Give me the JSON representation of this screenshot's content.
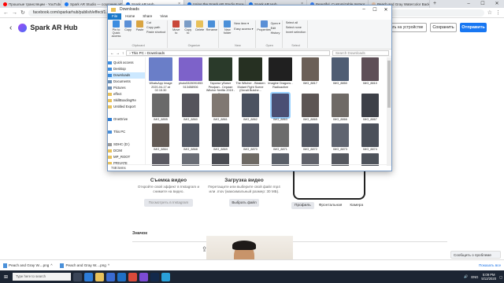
{
  "browser": {
    "tabs": [
      {
        "label": "Прошлые трансляции - YouTube",
        "color": "#ff0000"
      },
      {
        "label": "Spark AR Studio — создание эф...",
        "color": "#1877f2"
      },
      {
        "label": "Spark AR Hub",
        "color": "#1877f2",
        "active": true
      },
      {
        "label": "Using the Spark AR Studio Face...",
        "color": "#1877f2"
      },
      {
        "label": "Spark AR Hub",
        "color": "#1877f2"
      },
      {
        "label": "Beautiful, Customizable Instagr...",
        "color": "#3b82f6"
      },
      {
        "label": "Peach and Gray Watercolor Back...",
        "color": "#e3c2a8"
      }
    ],
    "url": "facebook.com/sparkarhub/publish/effect/1..."
  },
  "spark": {
    "title": "Spark AR Hub",
    "test_button": "Тестировать на устройстве",
    "save_button": "Сохранить",
    "send_button": "Отправить"
  },
  "explorer": {
    "title": "Downloads",
    "ribbon_tabs": [
      "File",
      "Home",
      "Share",
      "View"
    ],
    "groups": [
      {
        "label": "Clipboard",
        "items": [
          "Pin to Quick access",
          "Copy",
          "Paste"
        ],
        "small": [
          "Cut",
          "Copy path",
          "Paste shortcut"
        ]
      },
      {
        "label": "Organize",
        "items": [
          "Move to",
          "Copy to",
          "Delete",
          "Rename"
        ],
        "small": []
      },
      {
        "label": "New",
        "items": [
          "New folder"
        ],
        "small": [
          "New item ▾",
          "Easy access ▾"
        ]
      },
      {
        "label": "Open",
        "items": [
          "Properties"
        ],
        "small": [
          "Open ▾",
          "Edit",
          "History"
        ]
      },
      {
        "label": "Select",
        "items": [],
        "small": [
          "Select all",
          "Select none",
          "Invert selection"
        ]
      }
    ],
    "path": "› This PC › Downloads",
    "search_placeholder": "Search Downloads",
    "nav": [
      {
        "label": "Quick access",
        "icon": "#3c8de0"
      },
      {
        "label": "Desktop",
        "icon": "#3c8de0"
      },
      {
        "label": "Downloads",
        "icon": "#3c8de0",
        "selected": true
      },
      {
        "label": "Documents",
        "icon": "#6d8fb3"
      },
      {
        "label": "Pictures",
        "icon": "#6d8fb3"
      },
      {
        "label": "effect",
        "icon": "#e8c15a"
      },
      {
        "label": "SkillBoxdingRe",
        "icon": "#e8c15a"
      },
      {
        "label": "Untitled Export",
        "icon": "#e8c15a"
      },
      {
        "label": "",
        "icon": "transparent"
      },
      {
        "label": "OneDrive",
        "icon": "#2a7bd4"
      },
      {
        "label": "",
        "icon": "transparent"
      },
      {
        "label": "This PC",
        "icon": "#4a8fd8"
      },
      {
        "label": "",
        "icon": "transparent"
      },
      {
        "label": "SDHC (D:)",
        "icon": "#999999"
      },
      {
        "label": "DCIM",
        "icon": "#e8c15a"
      },
      {
        "label": "MP_ROOT",
        "icon": "#e8c15a"
      },
      {
        "label": "PRIVATE",
        "icon": "#e8c15a"
      },
      {
        "label": "System Volume I",
        "icon": "#e8c15a"
      }
    ],
    "files": [
      {
        "cap": "WhatsApp Image 2020-04-17 at 02.15.30",
        "color": "#6a7ec8",
        "wide": true
      },
      {
        "cap": "photo5328091553 513458906",
        "color": "#7d62c9",
        "wide": true
      },
      {
        "cap": "Гарольт убиект Реофан - Сериал Witcher Netflix 2019 - Б...",
        "color": "#2a3a2a",
        "wide": true
      },
      {
        "cap": "The Witcher - Blasken Mutant Fight Scene (Geralt Butche...",
        "color": "#263022",
        "wide": true
      },
      {
        "cap": "Imagine Dragons - Radioactive",
        "color": "#202020",
        "wide": true
      },
      {
        "cap": "IMG_8817",
        "color": "#6b5f57"
      },
      {
        "cap": "IMG_8850",
        "color": "#4f5d73"
      },
      {
        "cap": "IMG_8810",
        "color": "#5e4f57"
      },
      {
        "cap": "IMG_8855",
        "color": "#6a6a6a"
      },
      {
        "cap": "IMG_8860",
        "color": "#55545c"
      },
      {
        "cap": "IMG_8861",
        "color": "#807872"
      },
      {
        "cap": "IMG_8862",
        "color": "#4c5361"
      },
      {
        "cap": "IMG_8863",
        "color": "#4a4f74",
        "sel": true
      },
      {
        "cap": "IMG_8865",
        "color": "#5c5554"
      },
      {
        "cap": "IMG_8866",
        "color": "#6f6a66"
      },
      {
        "cap": "IMG_8867",
        "color": "#3d4048"
      },
      {
        "cap": "IMG_8864",
        "color": "#625a55"
      },
      {
        "cap": "IMG_8868",
        "color": "#565b66"
      },
      {
        "cap": "IMG_8869",
        "color": "#4d4f55"
      },
      {
        "cap": "IMG_8870",
        "color": "#5a5e6a"
      },
      {
        "cap": "IMG_8871",
        "color": "#6c6c6c"
      },
      {
        "cap": "IMG_8872",
        "color": "#545863"
      },
      {
        "cap": "IMG_8873",
        "color": "#5f6470"
      },
      {
        "cap": "IMG_8874",
        "color": "#4b505a"
      },
      {
        "cap": "IMG_8875",
        "color": "#5b5a62"
      },
      {
        "cap": "",
        "color": "#6a6d75"
      },
      {
        "cap": "",
        "color": "#4a4c52"
      },
      {
        "cap": "",
        "color": "#6e6a64"
      },
      {
        "cap": "",
        "color": "#5a5f68"
      },
      {
        "cap": "",
        "color": "#60626a"
      },
      {
        "cap": "",
        "color": "#55585f"
      },
      {
        "cap": "",
        "color": "#4e535b"
      }
    ],
    "status": "748 items"
  },
  "page": {
    "card1_title": "Съемка видео",
    "card1_text": "Откройте свой эффект в Instagram и снимите на видео.",
    "card1_button": "Посмотреть в Instagram",
    "card2_title": "Загрузка видео",
    "card2_text": "Перетащите или выберите свой файл mp4 или .mov (максимальный размер: 30 МБ).",
    "card2_button": "Выбрать файл",
    "preview_tabs": [
      "Профиль",
      "Фронтальная",
      "Камера"
    ],
    "section_title": "Значок",
    "help_button": "Сообщить о проблеме"
  },
  "downloads_bar": {
    "items": [
      "Peach and Gray W....png",
      "Peach and Gray W....png"
    ],
    "show_all": "Показать все"
  },
  "taskbar": {
    "search": "Type here to search",
    "lang": "ENG",
    "time": "5:09 PM",
    "date": "5/12/2020"
  }
}
